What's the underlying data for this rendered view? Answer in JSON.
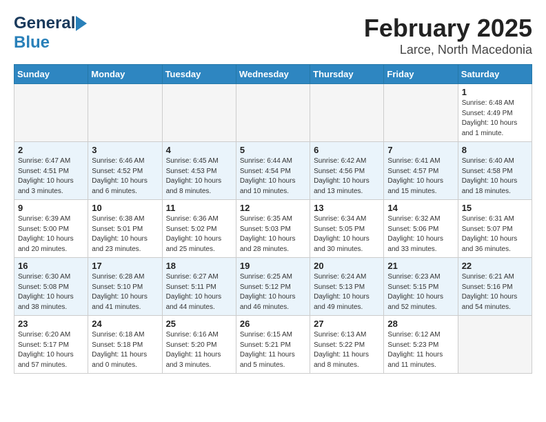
{
  "header": {
    "logo_general": "General",
    "logo_blue": "Blue",
    "month_title": "February 2025",
    "location": "Larce, North Macedonia"
  },
  "weekdays": [
    "Sunday",
    "Monday",
    "Tuesday",
    "Wednesday",
    "Thursday",
    "Friday",
    "Saturday"
  ],
  "weeks": [
    {
      "row_class": "row-white",
      "days": [
        {
          "num": "",
          "info": "",
          "empty": true
        },
        {
          "num": "",
          "info": "",
          "empty": true
        },
        {
          "num": "",
          "info": "",
          "empty": true
        },
        {
          "num": "",
          "info": "",
          "empty": true
        },
        {
          "num": "",
          "info": "",
          "empty": true
        },
        {
          "num": "",
          "info": "",
          "empty": true
        },
        {
          "num": "1",
          "info": "Sunrise: 6:48 AM\nSunset: 4:49 PM\nDaylight: 10 hours\nand 1 minute.",
          "empty": false
        }
      ]
    },
    {
      "row_class": "row-blue",
      "days": [
        {
          "num": "2",
          "info": "Sunrise: 6:47 AM\nSunset: 4:51 PM\nDaylight: 10 hours\nand 3 minutes.",
          "empty": false
        },
        {
          "num": "3",
          "info": "Sunrise: 6:46 AM\nSunset: 4:52 PM\nDaylight: 10 hours\nand 6 minutes.",
          "empty": false
        },
        {
          "num": "4",
          "info": "Sunrise: 6:45 AM\nSunset: 4:53 PM\nDaylight: 10 hours\nand 8 minutes.",
          "empty": false
        },
        {
          "num": "5",
          "info": "Sunrise: 6:44 AM\nSunset: 4:54 PM\nDaylight: 10 hours\nand 10 minutes.",
          "empty": false
        },
        {
          "num": "6",
          "info": "Sunrise: 6:42 AM\nSunset: 4:56 PM\nDaylight: 10 hours\nand 13 minutes.",
          "empty": false
        },
        {
          "num": "7",
          "info": "Sunrise: 6:41 AM\nSunset: 4:57 PM\nDaylight: 10 hours\nand 15 minutes.",
          "empty": false
        },
        {
          "num": "8",
          "info": "Sunrise: 6:40 AM\nSunset: 4:58 PM\nDaylight: 10 hours\nand 18 minutes.",
          "empty": false
        }
      ]
    },
    {
      "row_class": "row-white",
      "days": [
        {
          "num": "9",
          "info": "Sunrise: 6:39 AM\nSunset: 5:00 PM\nDaylight: 10 hours\nand 20 minutes.",
          "empty": false
        },
        {
          "num": "10",
          "info": "Sunrise: 6:38 AM\nSunset: 5:01 PM\nDaylight: 10 hours\nand 23 minutes.",
          "empty": false
        },
        {
          "num": "11",
          "info": "Sunrise: 6:36 AM\nSunset: 5:02 PM\nDaylight: 10 hours\nand 25 minutes.",
          "empty": false
        },
        {
          "num": "12",
          "info": "Sunrise: 6:35 AM\nSunset: 5:03 PM\nDaylight: 10 hours\nand 28 minutes.",
          "empty": false
        },
        {
          "num": "13",
          "info": "Sunrise: 6:34 AM\nSunset: 5:05 PM\nDaylight: 10 hours\nand 30 minutes.",
          "empty": false
        },
        {
          "num": "14",
          "info": "Sunrise: 6:32 AM\nSunset: 5:06 PM\nDaylight: 10 hours\nand 33 minutes.",
          "empty": false
        },
        {
          "num": "15",
          "info": "Sunrise: 6:31 AM\nSunset: 5:07 PM\nDaylight: 10 hours\nand 36 minutes.",
          "empty": false
        }
      ]
    },
    {
      "row_class": "row-blue",
      "days": [
        {
          "num": "16",
          "info": "Sunrise: 6:30 AM\nSunset: 5:08 PM\nDaylight: 10 hours\nand 38 minutes.",
          "empty": false
        },
        {
          "num": "17",
          "info": "Sunrise: 6:28 AM\nSunset: 5:10 PM\nDaylight: 10 hours\nand 41 minutes.",
          "empty": false
        },
        {
          "num": "18",
          "info": "Sunrise: 6:27 AM\nSunset: 5:11 PM\nDaylight: 10 hours\nand 44 minutes.",
          "empty": false
        },
        {
          "num": "19",
          "info": "Sunrise: 6:25 AM\nSunset: 5:12 PM\nDaylight: 10 hours\nand 46 minutes.",
          "empty": false
        },
        {
          "num": "20",
          "info": "Sunrise: 6:24 AM\nSunset: 5:13 PM\nDaylight: 10 hours\nand 49 minutes.",
          "empty": false
        },
        {
          "num": "21",
          "info": "Sunrise: 6:23 AM\nSunset: 5:15 PM\nDaylight: 10 hours\nand 52 minutes.",
          "empty": false
        },
        {
          "num": "22",
          "info": "Sunrise: 6:21 AM\nSunset: 5:16 PM\nDaylight: 10 hours\nand 54 minutes.",
          "empty": false
        }
      ]
    },
    {
      "row_class": "row-white",
      "days": [
        {
          "num": "23",
          "info": "Sunrise: 6:20 AM\nSunset: 5:17 PM\nDaylight: 10 hours\nand 57 minutes.",
          "empty": false
        },
        {
          "num": "24",
          "info": "Sunrise: 6:18 AM\nSunset: 5:18 PM\nDaylight: 11 hours\nand 0 minutes.",
          "empty": false
        },
        {
          "num": "25",
          "info": "Sunrise: 6:16 AM\nSunset: 5:20 PM\nDaylight: 11 hours\nand 3 minutes.",
          "empty": false
        },
        {
          "num": "26",
          "info": "Sunrise: 6:15 AM\nSunset: 5:21 PM\nDaylight: 11 hours\nand 5 minutes.",
          "empty": false
        },
        {
          "num": "27",
          "info": "Sunrise: 6:13 AM\nSunset: 5:22 PM\nDaylight: 11 hours\nand 8 minutes.",
          "empty": false
        },
        {
          "num": "28",
          "info": "Sunrise: 6:12 AM\nSunset: 5:23 PM\nDaylight: 11 hours\nand 11 minutes.",
          "empty": false
        },
        {
          "num": "",
          "info": "",
          "empty": true
        }
      ]
    }
  ]
}
